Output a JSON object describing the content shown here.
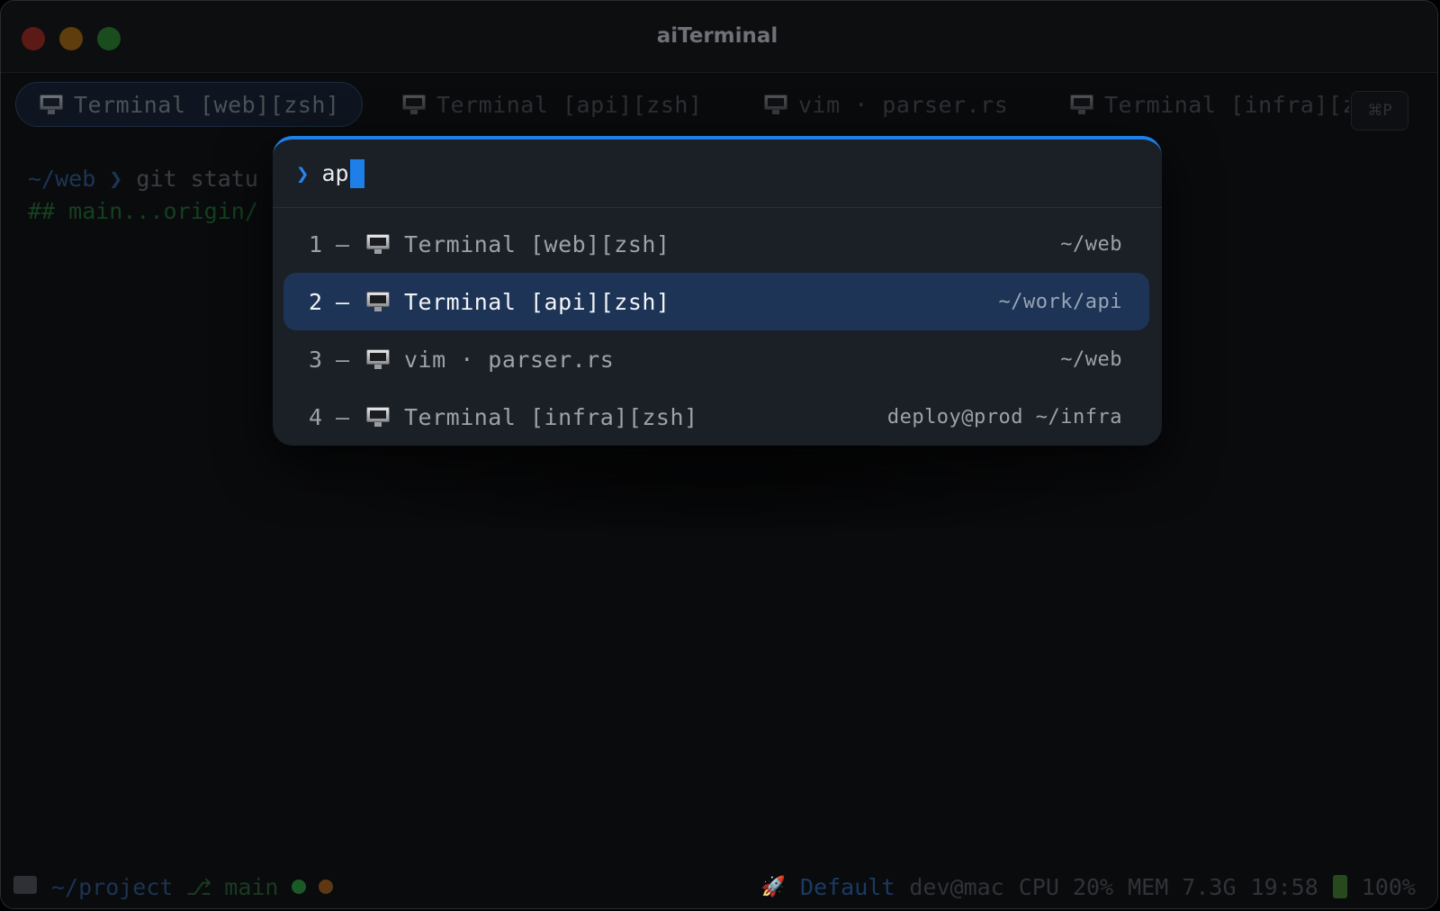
{
  "window": {
    "title": "aiTerminal"
  },
  "tabs": [
    {
      "label": "Terminal [web][zsh]",
      "icon": "monitor-icon",
      "active": true
    },
    {
      "label": "Terminal [api][zsh]",
      "icon": "monitor-icon",
      "active": false
    },
    {
      "label": "vim · parser.rs",
      "icon": "monitor-icon",
      "active": false
    },
    {
      "label": "Terminal [infra][zsh]",
      "icon": "monitor-icon",
      "active": false
    }
  ],
  "shortcut_hint": "⌘P",
  "terminal": {
    "line1_path": "~/web ❯ ",
    "line1_cmd": "git statu",
    "line2_output": "## main...origin/"
  },
  "palette": {
    "prompt_symbol": "❯",
    "query": "ap",
    "accent_color": "#1f7fe8",
    "items": [
      {
        "index": "1",
        "sep": "–",
        "icon": "monitor-icon",
        "label": "Terminal [web][zsh]",
        "dir": "~/web",
        "selected": false
      },
      {
        "index": "2",
        "sep": "–",
        "icon": "monitor-icon",
        "label": "Terminal [api][zsh]",
        "dir": "~/work/api",
        "selected": true
      },
      {
        "index": "3",
        "sep": "–",
        "icon": "monitor-icon",
        "label": "vim · parser.rs",
        "dir": "~/web",
        "selected": false
      },
      {
        "index": "4",
        "sep": "–",
        "icon": "monitor-icon",
        "label": "Terminal [infra][zsh]",
        "dir": "deploy@prod ~/infra",
        "selected": false
      }
    ]
  },
  "statusbar": {
    "path": "~/project",
    "branch_icon": "⎇",
    "branch": "main",
    "profile_icon": "🚀",
    "profile": "Default",
    "user": "dev@mac",
    "cpu": "CPU 20%",
    "mem": "MEM 7.3G",
    "time": "19:58",
    "battery": "100%"
  }
}
